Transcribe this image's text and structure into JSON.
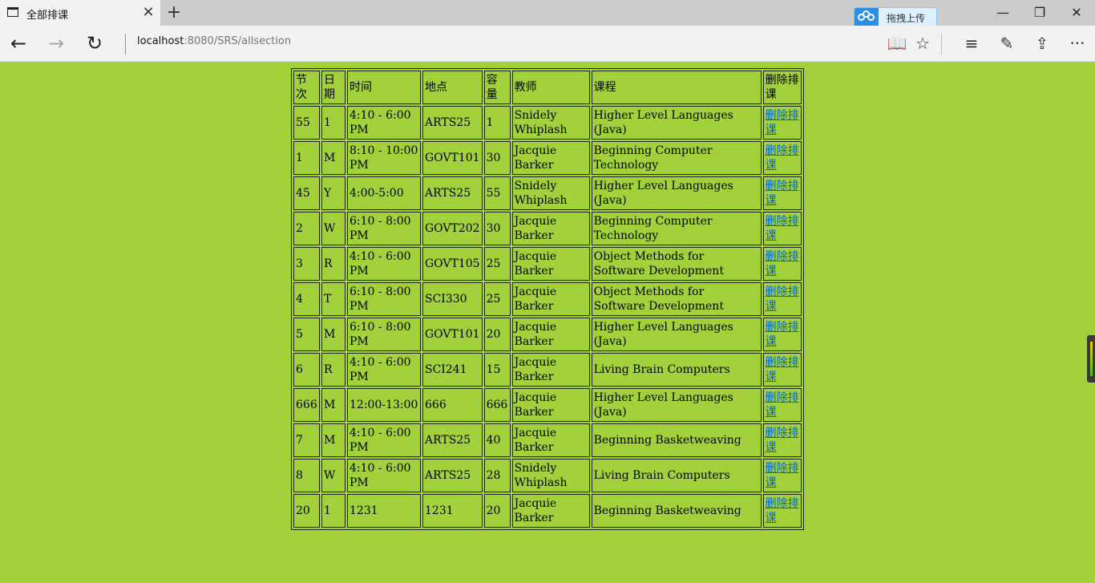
{
  "browser": {
    "tab_title": "全部排课",
    "tab_close": "×",
    "new_tab": "+",
    "upload_label": "拖拽上传",
    "address_host": "localhost",
    "address_path": ":8080/SRS/allsection",
    "window_controls": {
      "minimize": "—",
      "restore": "❐",
      "close": "✕"
    },
    "nav": {
      "back": "←",
      "forward": "→",
      "refresh": "↻"
    },
    "tools": {
      "reading_view": "📖",
      "favorite": "☆",
      "hub": "≡",
      "notes": "✎",
      "share": "⇪",
      "more": "···"
    }
  },
  "table": {
    "headers": [
      "节次",
      "日期",
      "时间",
      "地点",
      "容量",
      "教师",
      "课程",
      "删除排课"
    ],
    "delete_label": "删除排课",
    "rows": [
      [
        "55",
        "1",
        "4:10 - 6:00 PM",
        "ARTS25",
        "1",
        "Snidely Whiplash",
        "Higher Level Languages (Java)"
      ],
      [
        "1",
        "M",
        "8:10 - 10:00 PM",
        "GOVT101",
        "30",
        "Jacquie Barker",
        "Beginning Computer Technology"
      ],
      [
        "45",
        "Y",
        "4:00-5:00",
        "ARTS25",
        "55",
        "Snidely Whiplash",
        "Higher Level Languages (Java)"
      ],
      [
        "2",
        "W",
        "6:10 - 8:00 PM",
        "GOVT202",
        "30",
        "Jacquie Barker",
        "Beginning Computer Technology"
      ],
      [
        "3",
        "R",
        "4:10 - 6:00 PM",
        "GOVT105",
        "25",
        "Jacquie Barker",
        "Object Methods for Software Development"
      ],
      [
        "4",
        "T",
        "6:10 - 8:00 PM",
        "SCI330",
        "25",
        "Jacquie Barker",
        "Object Methods for Software Development"
      ],
      [
        "5",
        "M",
        "6:10 - 8:00 PM",
        "GOVT101",
        "20",
        "Jacquie Barker",
        "Higher Level Languages (Java)"
      ],
      [
        "6",
        "R",
        "4:10 - 6:00 PM",
        "SCI241",
        "15",
        "Jacquie Barker",
        "Living Brain Computers"
      ],
      [
        "666",
        "M",
        "12:00-13:00",
        "666",
        "666",
        "Jacquie Barker",
        "Higher Level Languages (Java)"
      ],
      [
        "7",
        "M",
        "4:10 - 6:00 PM",
        "ARTS25",
        "40",
        "Jacquie Barker",
        "Beginning Basketweaving"
      ],
      [
        "8",
        "W",
        "4:10 - 6:00 PM",
        "ARTS25",
        "28",
        "Snidely Whiplash",
        "Living Brain Computers"
      ],
      [
        "20",
        "1",
        "1231",
        "1231",
        "20",
        "Jacquie Barker",
        "Beginning Basketweaving"
      ]
    ]
  },
  "colors": {
    "page_background": "#a3d13c",
    "link": "#0066cc",
    "chrome": "#f2f2f2"
  }
}
